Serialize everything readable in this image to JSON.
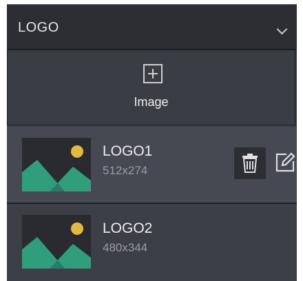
{
  "header": {
    "title": "LOGO",
    "chevron_icon": "chevron-down-icon"
  },
  "add_image": {
    "icon": "plus-square-icon",
    "label": "Image"
  },
  "items": [
    {
      "name": "LOGO1",
      "size": "512x274",
      "selected": true,
      "delete_icon": "trash-icon",
      "edit_icon": "edit-icon"
    },
    {
      "name": "LOGO2",
      "size": "480x344",
      "selected": false
    }
  ],
  "colors": {
    "panel_bg": "#3b3d44",
    "header_bg": "#2c2e33",
    "thumb_mountain": "#2f9e7a",
    "thumb_mountain_dark": "#22806a",
    "thumb_sun": "#e2b93b"
  }
}
